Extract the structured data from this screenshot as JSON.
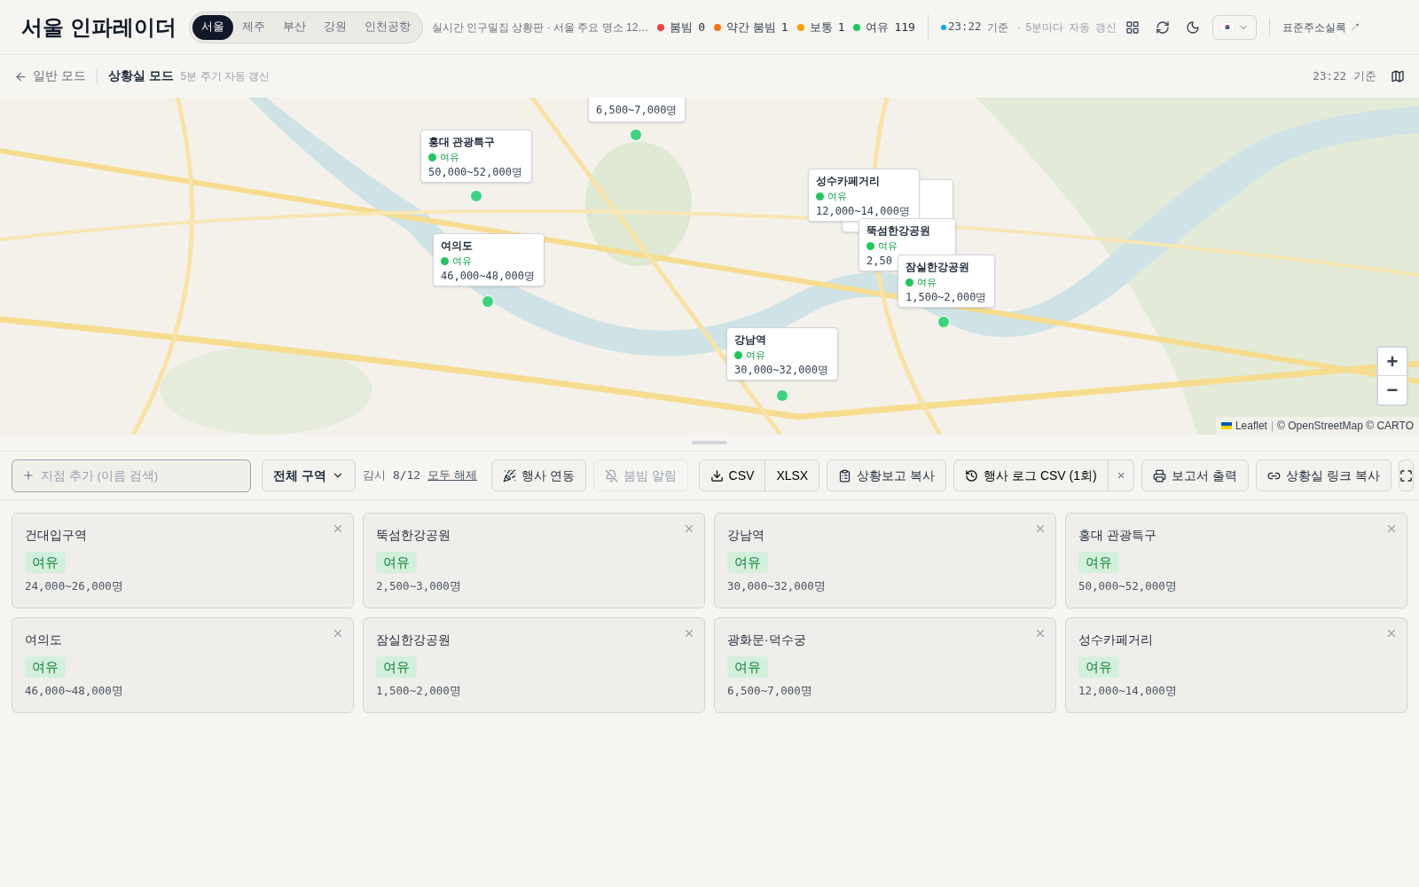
{
  "header": {
    "title": "서울 인파레이더",
    "regions": [
      {
        "label": "서울",
        "selected": true
      },
      {
        "label": "제주",
        "selected": false
      },
      {
        "label": "부산",
        "selected": false
      },
      {
        "label": "강원",
        "selected": false
      },
      {
        "label": "인천공항",
        "selected": false
      }
    ],
    "subtitle": "실시간 인구밀집 상황판 · 서울 주요 명소 12…",
    "legend": [
      {
        "label": "붐빔",
        "count": "0",
        "color": "#ef4444"
      },
      {
        "label": "약간 붐빔",
        "count": "1",
        "color": "#f97316"
      },
      {
        "label": "보통",
        "count": "1",
        "color": "#f59e0b"
      },
      {
        "label": "여유",
        "count": "119",
        "color": "#22c55e"
      }
    ],
    "time": "23:22",
    "time_suffix": "기준",
    "separator": "·",
    "refresh": [
      "5분마다",
      "자동",
      "갱신"
    ],
    "link": "표준주소실록 ↗"
  },
  "subbar": {
    "back": "일반 모드",
    "mode": "상황실 모드",
    "note": "5분 주기 자동 갱신",
    "time": "23:22",
    "time_suffix": "기준"
  },
  "map": {
    "popups": [
      {
        "kind": "count_only",
        "count": "6,500~7,000명"
      },
      {
        "kind": "full",
        "name": "홍대 관광특구",
        "status": "여유",
        "count": "50,000~52,000명"
      },
      {
        "kind": "full",
        "name": "여의도",
        "status": "여유",
        "count": "46,000~48,000명"
      },
      {
        "kind": "blank"
      },
      {
        "kind": "full",
        "name": "성수카페거리",
        "status": "여유",
        "count": "12,000~14,000명"
      },
      {
        "kind": "full",
        "name": "뚝섬한강공원",
        "status": "여유",
        "count": "2,50"
      },
      {
        "kind": "full",
        "name": "잠실한강공원",
        "status": "여유",
        "count": "1,500~2,000명"
      },
      {
        "kind": "full",
        "name": "강남역",
        "status": "여유",
        "count": "30,000~32,000명"
      }
    ],
    "zoom_in": "+",
    "zoom_out": "−",
    "attribution": [
      "Leaflet",
      "|",
      "© OpenStreetMap © CARTO"
    ]
  },
  "toolbar": {
    "search": {
      "placeholder": "지점 추가 (이름 검색)"
    },
    "zone": "전체 구역",
    "watch_label": "감시",
    "watch_count": "8/12",
    "clear": "모두 해제",
    "event": "행사 연동",
    "alert": {
      "label": "붐빔 알림",
      "disabled": true
    },
    "csv": "CSV",
    "xlsx": "XLSX",
    "copy_report": "상황보고 복사",
    "event_log": "행사 로그 CSV (1회)",
    "close": "×",
    "print": "보고서 출력",
    "copy_link": "상황실 링크 복사"
  },
  "cards": [
    {
      "name": "건대입구역",
      "status": "여유",
      "count": "24,000~26,000명"
    },
    {
      "name": "뚝섬한강공원",
      "status": "여유",
      "count": "2,500~3,000명"
    },
    {
      "name": "강남역",
      "status": "여유",
      "count": "30,000~32,000명"
    },
    {
      "name": "홍대 관광특구",
      "status": "여유",
      "count": "50,000~52,000명"
    },
    {
      "name": "여의도",
      "status": "여유",
      "count": "46,000~48,000명"
    },
    {
      "name": "잠실한강공원",
      "status": "여유",
      "count": "1,500~2,000명"
    },
    {
      "name": "광화문·덕수궁",
      "status": "여유",
      "count": "6,500~7,000명"
    },
    {
      "name": "성수카페거리",
      "status": "여유",
      "count": "12,000~14,000명"
    }
  ]
}
